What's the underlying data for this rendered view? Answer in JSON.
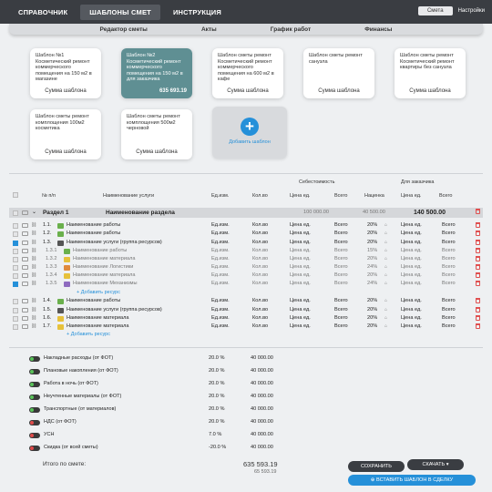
{
  "topnav": {
    "items": [
      "СПРАВОЧНИК",
      "ШАБЛОНЫ СМЕТ",
      "ИНСТРУКЦИЯ"
    ],
    "right_pill": "Смета",
    "right_link": "Настройки"
  },
  "subnav": [
    "Редактор сметы",
    "Акты",
    "График работ",
    "Финансы"
  ],
  "cards": [
    {
      "title": "Шаблон №1 Косметический ремонт коммерческого помещения на 150 м2 в магазине",
      "sum": "Сумма шаблона"
    },
    {
      "title": "Шаблон №2 Косметический ремонт коммерческого помещения на 150 м2 в для заказчика",
      "sum": "635 693.19"
    },
    {
      "title": "Шаблон сметы ремонт Косметический ремонт коммерческого помещения на 600 м2 в кафе",
      "sum": "Сумма шаблона"
    },
    {
      "title": "Шаблон сметы ремонт санузла",
      "sum": "Сумма шаблона"
    },
    {
      "title": "Шаблон сметы ремонт Косметический ремонт квартиры без санузла",
      "sum": "Сумма шаблона"
    },
    {
      "title": "Шаблон сметы ремонт комплощения 100м2 косметика",
      "sum": "Сумма шаблона"
    },
    {
      "title": "Шаблон сметы ремонт комплощения 500м2 черновой",
      "sum": "Сумма шаблона"
    }
  ],
  "add_template": "Добавить шаблон",
  "head": {
    "sebest": "Себестоимость",
    "zakaz": "Для заказчика",
    "num": "№ п/п",
    "name": "Наименование услуги",
    "unit": "Ед.изм.",
    "qty": "Кол.во",
    "price": "Цена ед.",
    "total": "Всего",
    "markup": "Наценка",
    "price2": "Цена ед.",
    "total2": "Всего"
  },
  "section": {
    "name": "Раздел 1",
    "title": "Наименование раздела",
    "cost": "100 000.00",
    "markup": "40 500.00",
    "total": "140 500.00"
  },
  "rows": [
    {
      "n": "1.1.",
      "name": "Наименование работы",
      "unit": "Ед.изм.",
      "qty": "Кол.во",
      "price": "Цена ед.",
      "total": "Всего",
      "mk": "20%",
      "p2": "Цена ед.",
      "t2": "Всего",
      "sub": false,
      "cb": false,
      "tag": "#6ab04c"
    },
    {
      "n": "1.2.",
      "name": "Наименование работы",
      "unit": "Ед.изм.",
      "qty": "Кол.во",
      "price": "Цена ед.",
      "total": "Всего",
      "mk": "20%",
      "p2": "Цена ед.",
      "t2": "Всего",
      "sub": false,
      "cb": false,
      "tag": "#6ab04c"
    },
    {
      "n": "1.3.",
      "name": "Наименование услуги (группа ресурсов)",
      "unit": "Ед.изм.",
      "qty": "Кол.во",
      "price": "Цена ед.",
      "total": "Всего",
      "mk": "20%",
      "p2": "Цена ед.",
      "t2": "Всего",
      "sub": false,
      "cb": true,
      "tag": "#555555"
    },
    {
      "n": "1.3.1",
      "name": "Наименование работы",
      "unit": "Ед.изм.",
      "qty": "Кол.во",
      "price": "Цена ед.",
      "total": "Всего",
      "mk": "15%",
      "p2": "Цена ед.",
      "t2": "Всего",
      "sub": true,
      "cb": false,
      "tag": "#6ab04c"
    },
    {
      "n": "1.3.2",
      "name": "Наименование материала",
      "unit": "Ед.изм.",
      "qty": "Кол.во",
      "price": "Цена ед.",
      "total": "Всего",
      "mk": "20%",
      "p2": "Цена ед.",
      "t2": "Всего",
      "sub": true,
      "cb": false,
      "tag": "#e6c13b"
    },
    {
      "n": "1.3.3",
      "name": "Наименование Логистики",
      "unit": "Ед.изм.",
      "qty": "Кол.во",
      "price": "Цена ед.",
      "total": "Всего",
      "mk": "24%",
      "p2": "Цена ед.",
      "t2": "Всего",
      "sub": true,
      "cb": false,
      "tag": "#e08a3c"
    },
    {
      "n": "1.3.4",
      "name": "Наименование материала",
      "unit": "Ед.изм.",
      "qty": "Кол.во",
      "price": "Цена ед.",
      "total": "Всего",
      "mk": "20%",
      "p2": "Цена ед.",
      "t2": "Всего",
      "sub": true,
      "cb": false,
      "tag": "#e6c13b"
    },
    {
      "n": "1.3.5",
      "name": "Наименование Механизмы",
      "unit": "Ед.изм.",
      "qty": "Кол.во",
      "price": "Цена ед.",
      "total": "Всего",
      "mk": "24%",
      "p2": "Цена ед.",
      "t2": "Всего",
      "sub": true,
      "cb": true,
      "tag": "#8e6bbf"
    },
    {
      "n": "1.4.",
      "name": "Наименование работы",
      "unit": "Ед.изм.",
      "qty": "Кол.во",
      "price": "Цена ед.",
      "total": "Всего",
      "mk": "20%",
      "p2": "Цена ед.",
      "t2": "Всего",
      "sub": false,
      "cb": false,
      "tag": "#6ab04c"
    },
    {
      "n": "1.5.",
      "name": "Наименование услуги (группа ресурсов)",
      "unit": "Ед.изм.",
      "qty": "Кол.во",
      "price": "Цена ед.",
      "total": "Всего",
      "mk": "20%",
      "p2": "Цена ед.",
      "t2": "Всего",
      "sub": false,
      "cb": false,
      "tag": "#555555"
    },
    {
      "n": "1.6.",
      "name": "Наименование материала",
      "unit": "Ед.изм.",
      "qty": "Кол.во",
      "price": "Цена ед.",
      "total": "Всего",
      "mk": "20%",
      "p2": "Цена ед.",
      "t2": "Всего",
      "sub": false,
      "cb": false,
      "tag": "#e6c13b"
    },
    {
      "n": "1.7.",
      "name": "Наименование материала",
      "unit": "Ед.изм.",
      "qty": "Кол.во",
      "price": "Цена ед.",
      "total": "Всего",
      "mk": "20%",
      "p2": "Цена ед.",
      "t2": "Всего",
      "sub": false,
      "cb": false,
      "tag": "#e6c13b"
    }
  ],
  "add_resource": "+ Добавить ресурс",
  "summary": [
    {
      "label": "Накладные расходы (от ФОТ)",
      "pct": "20.0 %",
      "val": "40 000.00",
      "on": true
    },
    {
      "label": "Плановые накопления (от ФОТ)",
      "pct": "20.0 %",
      "val": "40 000.00",
      "on": true
    },
    {
      "label": "Работа в ночь (от ФОТ)",
      "pct": "20.0 %",
      "val": "40 000.00",
      "on": true
    },
    {
      "label": "Неучтенные материалы (от ФОТ)",
      "pct": "20.0 %",
      "val": "40 000.00",
      "on": true
    },
    {
      "label": "Транспортные (от материалов)",
      "pct": "20.0 %",
      "val": "40 000.00",
      "on": true
    },
    {
      "label": "НДС (от ФОТ)",
      "pct": "20.0 %",
      "val": "40 000.00",
      "on": false
    },
    {
      "label": "УСН",
      "pct": "7.0 %",
      "val": "40 000.00",
      "on": false
    },
    {
      "label": "Скидка (от всей сметы)",
      "pct": "-20.0 %",
      "val": "40 000.00",
      "on": false
    }
  ],
  "total": {
    "label": "Итого по смете:",
    "value": "635 593.19",
    "sub": "65 593.19"
  },
  "buttons": {
    "save": "СОХРАНИТЬ",
    "download": "СКАЧАТЬ",
    "insert": "ВСТАВИТЬ ШАБЛОН В СДЕЛКУ"
  }
}
